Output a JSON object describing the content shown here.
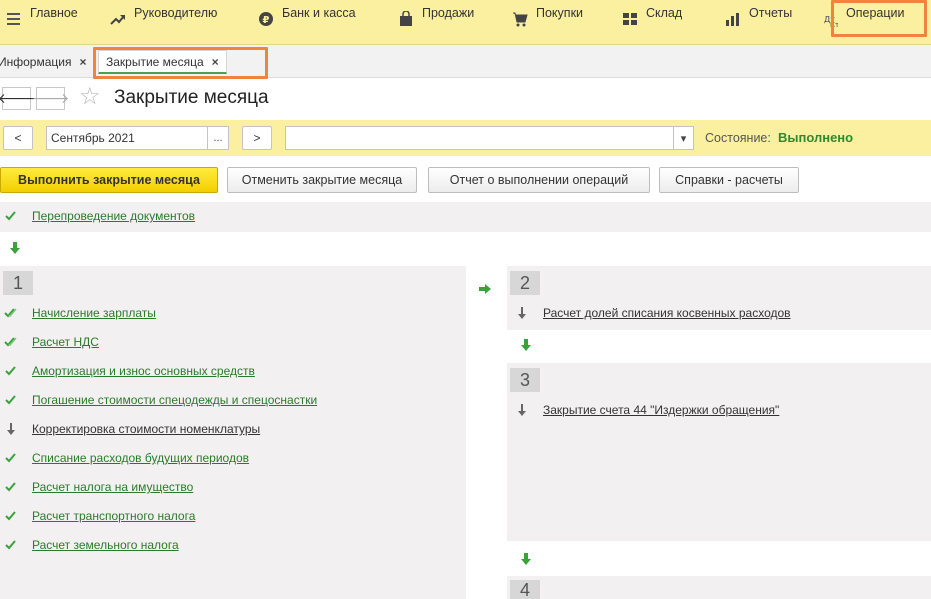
{
  "menu": {
    "items": [
      {
        "label": "Главное",
        "icon": "hamburger-icon"
      },
      {
        "label": "Руководителю",
        "icon": "trend-icon"
      },
      {
        "label": "Банк и касса",
        "icon": "ruble-coin-icon"
      },
      {
        "label": "Продажи",
        "icon": "shopping-bag-icon"
      },
      {
        "label": "Покупки",
        "icon": "cart-icon"
      },
      {
        "label": "Склад",
        "icon": "warehouse-grid-icon"
      },
      {
        "label": "Отчеты",
        "icon": "bar-chart-icon"
      },
      {
        "label": "Операции",
        "icon": "dt-kt-icon"
      }
    ],
    "highlight_color": "#f0843c"
  },
  "tabs": [
    {
      "label": "Информация",
      "close": "×"
    },
    {
      "label": "Закрытие месяца",
      "close": "×"
    }
  ],
  "header": {
    "back": "🡐",
    "forward": "🡒",
    "title": "Закрытие месяца"
  },
  "period": {
    "prev": "<",
    "value": "Сентябрь 2021",
    "select_button": "...",
    "next": ">",
    "organization": "",
    "dropdown": "▾",
    "state_label": "Состояние:",
    "state_value": "Выполнено"
  },
  "actions": {
    "run": "Выполнить закрытие месяца",
    "cancel": "Отменить закрытие месяца",
    "report": "Отчет о выполнении операций",
    "refs": "Справки - расчеты"
  },
  "pre_step": {
    "label": "Перепроведение документов",
    "status": "done"
  },
  "steps": [
    {
      "number": "1",
      "operations": [
        {
          "label": "Начисление зарплаты",
          "status": "done-double"
        },
        {
          "label": "Расчет НДС",
          "status": "done-double"
        },
        {
          "label": "Амортизация и износ основных средств",
          "status": "done"
        },
        {
          "label": "Погашение стоимости спецодежды и спецоснастки",
          "status": "done"
        },
        {
          "label": "Корректировка стоимости номенклатуры",
          "status": "not-required"
        },
        {
          "label": "Списание расходов будущих периодов",
          "status": "done"
        },
        {
          "label": "Расчет налога на имущество",
          "status": "done"
        },
        {
          "label": "Расчет транспортного налога",
          "status": "done"
        },
        {
          "label": "Расчет земельного налога",
          "status": "done"
        }
      ]
    },
    {
      "number": "2",
      "operations": [
        {
          "label": "Расчет долей списания косвенных расходов",
          "status": "not-required"
        }
      ]
    },
    {
      "number": "3",
      "operations": [
        {
          "label": "Закрытие счета 44 \"Издержки обращения\"",
          "status": "not-required"
        }
      ]
    },
    {
      "number": "4",
      "operations": []
    }
  ],
  "colors": {
    "menu_bg": "#fbf0a0",
    "done_green": "#3aa23a",
    "primary_yellow": "#f3cf00"
  }
}
